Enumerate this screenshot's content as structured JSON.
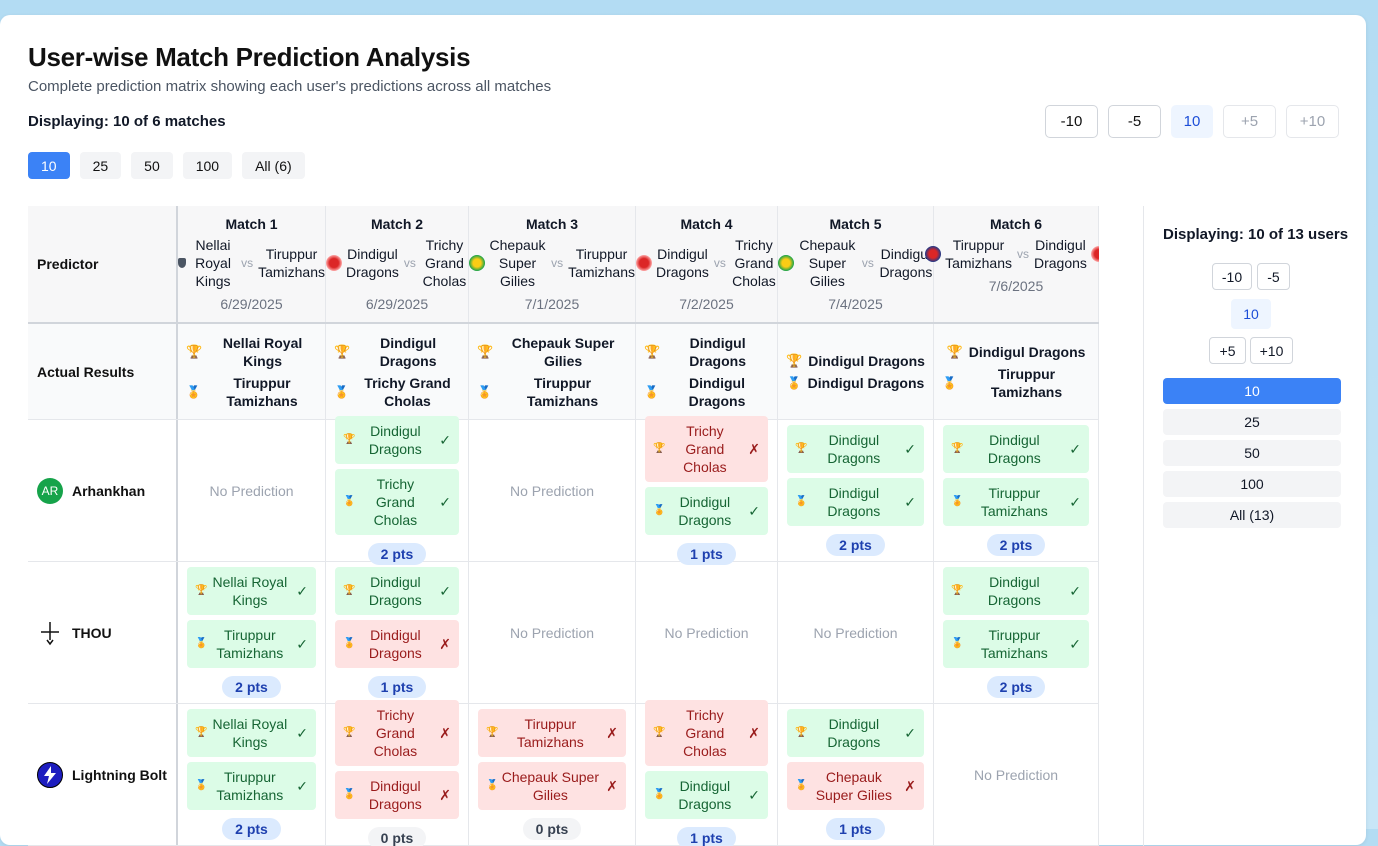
{
  "header": {
    "title": "User-wise Match Prediction Analysis",
    "subtitle": "Complete prediction matrix showing each user's predictions across all matches",
    "displaying": "Displaying: 10 of 6 matches"
  },
  "match_stepper": [
    "-10",
    "-5",
    "10",
    "+5",
    "+10"
  ],
  "page_sizes": [
    "10",
    "25",
    "50",
    "100",
    "All (6)"
  ],
  "table": {
    "predictor_label": "Predictor",
    "actual_label": "Actual Results",
    "no_prediction": "No Prediction",
    "vs": "vs",
    "matches": [
      {
        "title": "Match 1",
        "team_a": "Nellai Royal Kings",
        "team_b": "Tiruppur Tamizhans",
        "date": "6/29/2025",
        "winner": "Nellai Royal Kings",
        "other": "Tiruppur Tamizhans"
      },
      {
        "title": "Match 2",
        "team_a": "Dindigul Dragons",
        "team_b": "Trichy Grand Cholas",
        "date": "6/29/2025",
        "winner": "Dindigul Dragons",
        "other": "Trichy Grand Cholas"
      },
      {
        "title": "Match 3",
        "team_a": "Chepauk Super Gilies",
        "team_b": "Tiruppur Tamizhans",
        "date": "7/1/2025",
        "winner": "Chepauk Super Gilies",
        "other": "Tiruppur Tamizhans"
      },
      {
        "title": "Match 4",
        "team_a": "Dindigul Dragons",
        "team_b": "Trichy Grand Cholas",
        "date": "7/2/2025",
        "winner": "Dindigul Dragons",
        "other": "Dindigul Dragons"
      },
      {
        "title": "Match 5",
        "team_a": "Chepauk Super Gilies",
        "team_b": "Dindigul Dragons",
        "date": "7/4/2025",
        "winner": "Dindigul Dragons",
        "other": "Dindigul Dragons"
      },
      {
        "title": "Match 6",
        "team_a": "Tiruppur Tamizhans",
        "team_b": "Dindigul Dragons",
        "date": "7/6/2025",
        "winner": "Dindigul Dragons",
        "other": "Tiruppur Tamizhans"
      }
    ],
    "users": [
      {
        "name": "Arhankhan",
        "initials": "AR",
        "preds": [
          null,
          {
            "p1": "Dindigul Dragons",
            "ok1": true,
            "p2": "Trichy Grand Cholas",
            "ok2": true,
            "pts": "2 pts"
          },
          null,
          {
            "p1": "Trichy Grand Cholas",
            "ok1": false,
            "p2": "Dindigul Dragons",
            "ok2": true,
            "pts": "1 pts"
          },
          {
            "p1": "Dindigul Dragons",
            "ok1": true,
            "p2": "Dindigul Dragons",
            "ok2": true,
            "pts": "2 pts"
          },
          {
            "p1": "Dindigul Dragons",
            "ok1": true,
            "p2": "Tiruppur Tamizhans",
            "ok2": true,
            "pts": "2 pts"
          }
        ]
      },
      {
        "name": "THOU",
        "initials": "",
        "preds": [
          {
            "p1": "Nellai Royal Kings",
            "ok1": true,
            "p2": "Tiruppur Tamizhans",
            "ok2": true,
            "pts": "2 pts"
          },
          {
            "p1": "Dindigul Dragons",
            "ok1": true,
            "p2": "Dindigul Dragons",
            "ok2": false,
            "pts": "1 pts"
          },
          null,
          null,
          null,
          {
            "p1": "Dindigul Dragons",
            "ok1": true,
            "p2": "Tiruppur Tamizhans",
            "ok2": true,
            "pts": "2 pts"
          }
        ]
      },
      {
        "name": "Lightning Bolt",
        "initials": "",
        "preds": [
          {
            "p1": "Nellai Royal Kings",
            "ok1": true,
            "p2": "Tiruppur Tamizhans",
            "ok2": true,
            "pts": "2 pts"
          },
          {
            "p1": "Trichy Grand Cholas",
            "ok1": false,
            "p2": "Dindigul Dragons",
            "ok2": false,
            "pts": "0 pts"
          },
          {
            "p1": "Tiruppur Tamizhans",
            "ok1": false,
            "p2": "Chepauk Super Gilies",
            "ok2": false,
            "pts": "0 pts"
          },
          {
            "p1": "Trichy Grand Cholas",
            "ok1": false,
            "p2": "Dindigul Dragons",
            "ok2": true,
            "pts": "1 pts"
          },
          {
            "p1": "Dindigul Dragons",
            "ok1": true,
            "p2": "Chepauk Super Gilies",
            "ok2": false,
            "pts": "1 pts"
          },
          null
        ]
      }
    ]
  },
  "side": {
    "displaying": "Displaying: 10 of 13 users",
    "stepper": [
      "-10",
      "-5",
      "10",
      "+5",
      "+10"
    ],
    "page_sizes": [
      "10",
      "25",
      "50",
      "100",
      "All (13)"
    ]
  },
  "colors": {
    "accent": "#3b82f6",
    "correct_bg": "#dcfce7",
    "wrong_bg": "#fee2e2",
    "points_bg": "#dbeafe"
  },
  "icons": {
    "winner": "trophy-icon",
    "runner": "medal-icon",
    "correct": "check-icon",
    "wrong": "cross-icon"
  }
}
